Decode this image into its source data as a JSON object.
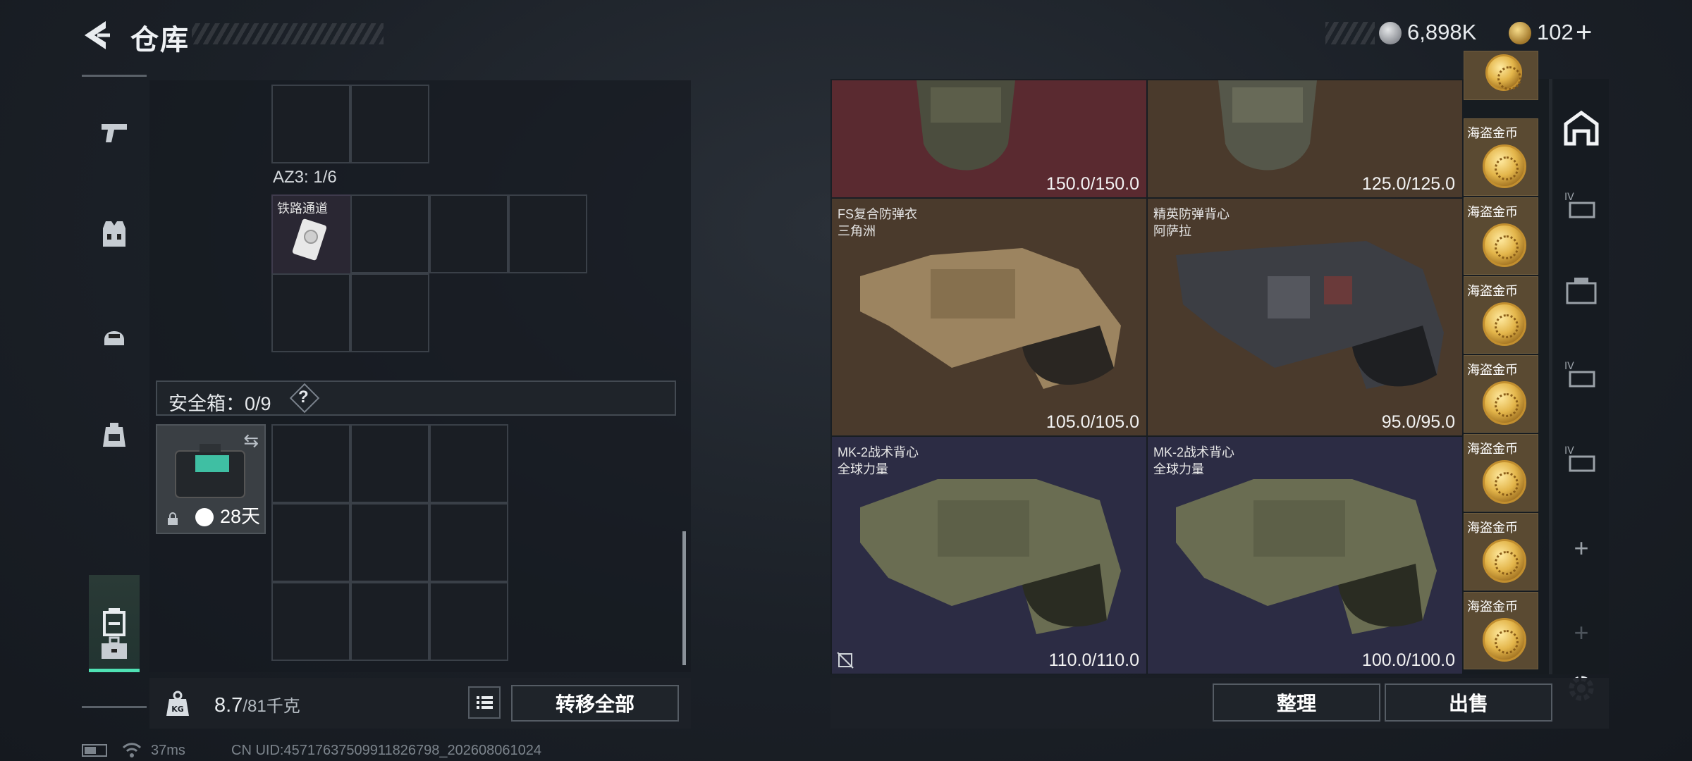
{
  "header": {
    "title": "仓库",
    "silver_amount": "6,898K",
    "gold_amount": "102"
  },
  "left_rail": {
    "items": [
      {
        "icon": "pistol-icon"
      },
      {
        "icon": "vest-icon"
      },
      {
        "icon": "helmet-icon"
      },
      {
        "icon": "backpack-icon"
      },
      {
        "icon": "safe-box-icon"
      },
      {
        "icon": "toolbox-icon"
      }
    ],
    "active_index": 4
  },
  "backpack": {
    "az3_label": "AZ3: 1/6",
    "az3_item_name": "铁路通道"
  },
  "safebox": {
    "label": "安全箱：0/9",
    "help": "?",
    "timer": "28天"
  },
  "bottom_left": {
    "weight": "8.7",
    "weight_max": "/81千克",
    "transfer_all": "转移全部"
  },
  "warehouse": {
    "items": [
      {
        "name1": "",
        "name2": "",
        "durability": "150.0/150.0",
        "bg": "#5a2a30"
      },
      {
        "name1": "",
        "name2": "",
        "durability": "125.0/125.0",
        "bg": "#4a3a2c"
      },
      {
        "name1": "FS复合防弹衣",
        "name2": "三角洲",
        "durability": "105.0/105.0",
        "bg": "#4a3a2c"
      },
      {
        "name1": "精英防弹背心",
        "name2": "阿萨拉",
        "durability": "95.0/95.0",
        "bg": "#4a3a2c"
      },
      {
        "name1": "MK-2战术背心",
        "name2": "全球力量",
        "durability": "110.0/110.0",
        "bg": "#2c2c44"
      },
      {
        "name1": "MK-2战术背心",
        "name2": "全球力量",
        "durability": "100.0/100.0",
        "bg": "#2c2c44"
      }
    ],
    "coins": [
      {
        "name": "海盗金币"
      },
      {
        "name": "海盗金币"
      },
      {
        "name": "海盗金币"
      },
      {
        "name": "海盗金币"
      },
      {
        "name": "海盗金币"
      },
      {
        "name": "海盗金币"
      },
      {
        "name": "海盗金币"
      }
    ]
  },
  "bottom_right": {
    "sort": "整理",
    "sell": "出售"
  },
  "status": {
    "ping": "37ms",
    "uid": "CN UID:45717637509911826798_202608061024"
  }
}
